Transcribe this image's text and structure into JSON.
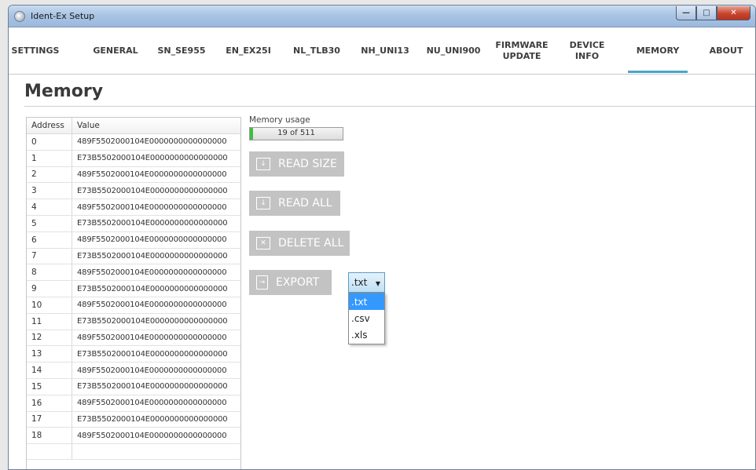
{
  "window": {
    "title": "Ident-Ex Setup"
  },
  "tabs": [
    {
      "label": "SETTINGS"
    },
    {
      "label": "GENERAL"
    },
    {
      "label": "SN_SE955"
    },
    {
      "label": "EN_EX25I"
    },
    {
      "label": "NL_TLB30"
    },
    {
      "label": "NH_UNI13"
    },
    {
      "label": "NU_UNI900"
    },
    {
      "label": "FIRMWARE\nUPDATE"
    },
    {
      "label": "DEVICE\nINFO"
    },
    {
      "label": "MEMORY",
      "active": true
    },
    {
      "label": "ABOUT"
    }
  ],
  "page": {
    "title": "Memory"
  },
  "table": {
    "headers": {
      "address": "Address",
      "value": "Value"
    },
    "rows": [
      {
        "address": "0",
        "value": "489F5502000104E0000000000000000"
      },
      {
        "address": "1",
        "value": "E73B5502000104E0000000000000000"
      },
      {
        "address": "2",
        "value": "489F5502000104E0000000000000000"
      },
      {
        "address": "3",
        "value": "E73B5502000104E0000000000000000"
      },
      {
        "address": "4",
        "value": "489F5502000104E0000000000000000"
      },
      {
        "address": "5",
        "value": "E73B5502000104E0000000000000000"
      },
      {
        "address": "6",
        "value": "489F5502000104E0000000000000000"
      },
      {
        "address": "7",
        "value": "E73B5502000104E0000000000000000"
      },
      {
        "address": "8",
        "value": "489F5502000104E0000000000000000"
      },
      {
        "address": "9",
        "value": "E73B5502000104E0000000000000000"
      },
      {
        "address": "10",
        "value": "489F5502000104E0000000000000000"
      },
      {
        "address": "11",
        "value": "E73B5502000104E0000000000000000"
      },
      {
        "address": "12",
        "value": "489F5502000104E0000000000000000"
      },
      {
        "address": "13",
        "value": "E73B5502000104E0000000000000000"
      },
      {
        "address": "14",
        "value": "489F5502000104E0000000000000000"
      },
      {
        "address": "15",
        "value": "E73B5502000104E0000000000000000"
      },
      {
        "address": "16",
        "value": "489F5502000104E0000000000000000"
      },
      {
        "address": "17",
        "value": "E73B5502000104E0000000000000000"
      },
      {
        "address": "18",
        "value": "489F5502000104E0000000000000000"
      }
    ]
  },
  "memory_usage": {
    "label": "Memory usage",
    "text": "19 of 511",
    "used": 19,
    "total": 511
  },
  "buttons": {
    "read_size": "READ SIZE",
    "read_all": "READ ALL",
    "delete_all": "DELETE ALL",
    "export": "EXPORT"
  },
  "export_format": {
    "selected": ".txt",
    "options": [
      ".txt",
      ".csv",
      ".xls"
    ]
  },
  "colors": {
    "accent": "#4aa6c8",
    "button_gray": "#c3c3c3",
    "selection": "#3399ff"
  }
}
